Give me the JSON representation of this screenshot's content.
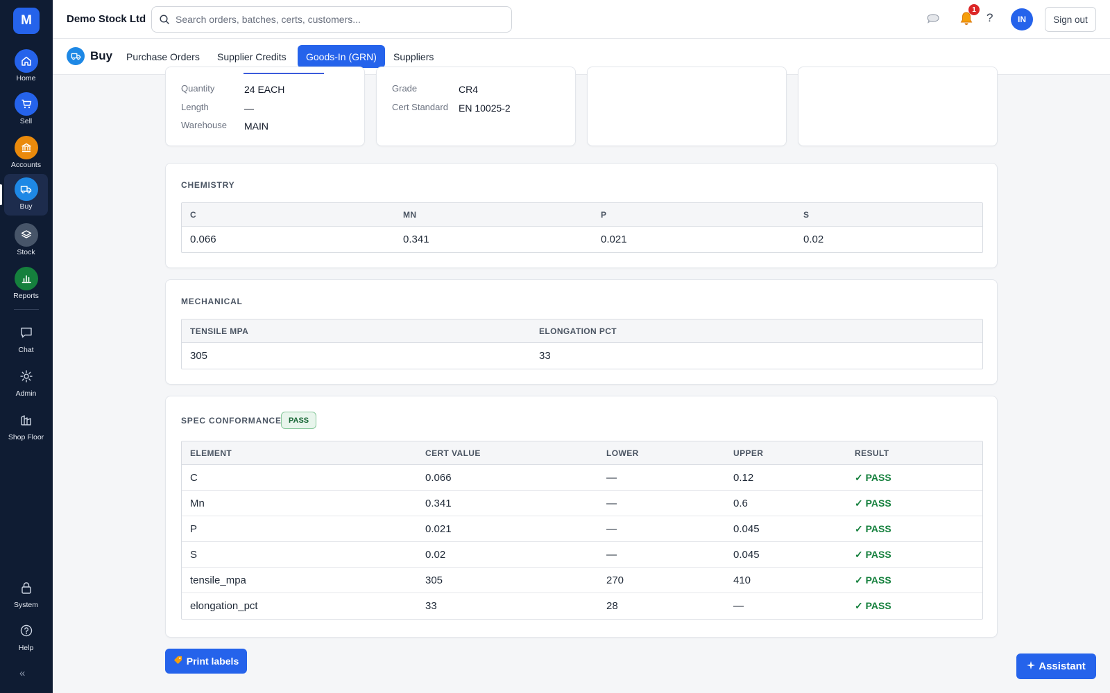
{
  "sidebar": {
    "logo": "M",
    "items": [
      {
        "label": "Home",
        "icon": "home-icon",
        "color": "#2563eb"
      },
      {
        "label": "Sell",
        "icon": "cart-icon",
        "color": "#2563eb"
      },
      {
        "label": "Accounts",
        "icon": "bank-icon",
        "color": "#ea8a0c"
      },
      {
        "label": "Buy",
        "icon": "truck-icon",
        "color": "#1e88e5"
      },
      {
        "label": "Stock",
        "icon": "layers-icon",
        "color": "#475569"
      },
      {
        "label": "Reports",
        "icon": "bar-chart-icon",
        "color": "#15803d"
      },
      {
        "label": "Chat",
        "icon": "chat-icon"
      },
      {
        "label": "Admin",
        "icon": "gear-icon"
      },
      {
        "label": "Shop Floor",
        "icon": "factory-icon"
      },
      {
        "label": "System",
        "icon": "lock-icon"
      },
      {
        "label": "Help",
        "icon": "help-icon"
      }
    ],
    "collapse": "«"
  },
  "header": {
    "company": "Demo Stock Ltd",
    "search_placeholder": "Search orders, batches, certs, customers...",
    "notifications_count": "1",
    "help": "?",
    "avatar": "IN",
    "signout": "Sign out"
  },
  "subnav": {
    "title": "Buy",
    "tabs": [
      "Purchase Orders",
      "Supplier Credits",
      "Goods-In (GRN)",
      "Suppliers"
    ],
    "active_tab": "Goods-In (GRN)"
  },
  "details": {
    "card1": [
      {
        "label": "Quantity",
        "value": "24 EACH"
      },
      {
        "label": "Length",
        "value": "—"
      },
      {
        "label": "Warehouse",
        "value": "MAIN"
      }
    ],
    "card2": [
      {
        "label": "Grade",
        "value": "CR4"
      },
      {
        "label": "Cert Standard",
        "value": "EN 10025-2"
      }
    ]
  },
  "chemistry": {
    "title": "CHEMISTRY",
    "headers": [
      "C",
      "MN",
      "P",
      "S"
    ],
    "row": [
      "0.066",
      "0.341",
      "0.021",
      "0.02"
    ]
  },
  "mechanical": {
    "title": "MECHANICAL",
    "headers": [
      "TENSILE MPA",
      "ELONGATION PCT"
    ],
    "row": [
      "305",
      "33"
    ]
  },
  "spec": {
    "title": "SPEC CONFORMANCE",
    "status": "PASS",
    "headers": [
      "ELEMENT",
      "CERT VALUE",
      "LOWER",
      "UPPER",
      "RESULT"
    ],
    "rows": [
      [
        "C",
        "0.066",
        "—",
        "0.12",
        "✓ PASS"
      ],
      [
        "Mn",
        "0.341",
        "—",
        "0.6",
        "✓ PASS"
      ],
      [
        "P",
        "0.021",
        "—",
        "0.045",
        "✓ PASS"
      ],
      [
        "S",
        "0.02",
        "—",
        "0.045",
        "✓ PASS"
      ],
      [
        "tensile_mpa",
        "305",
        "270",
        "410",
        "✓ PASS"
      ],
      [
        "elongation_pct",
        "33",
        "28",
        "—",
        "✓ PASS"
      ]
    ]
  },
  "actions": {
    "print_labels": "Print labels",
    "assistant": "Assistant"
  }
}
